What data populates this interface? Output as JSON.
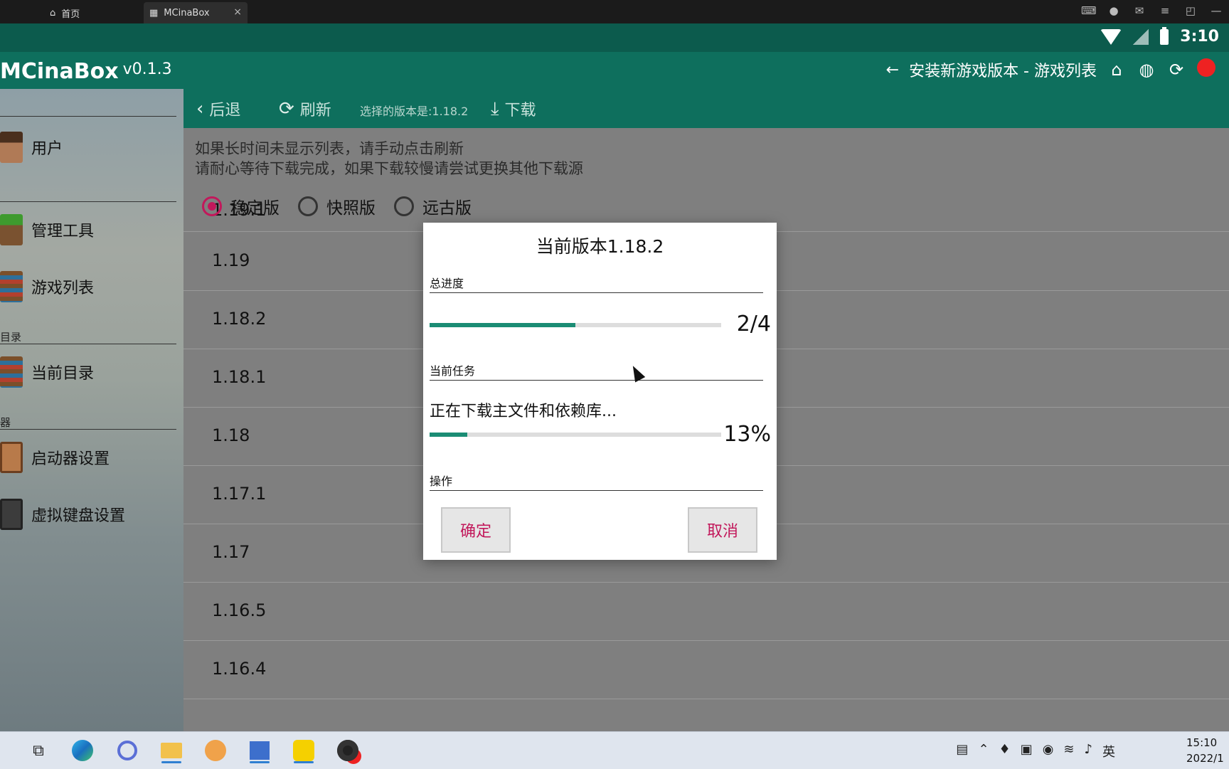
{
  "browser": {
    "tabs": [
      {
        "label": "首页",
        "icon": "home-icon"
      },
      {
        "label": "MCinaBox",
        "icon": "minecraft-icon",
        "close": "×"
      }
    ],
    "window_controls": [
      "gamepad-icon",
      "account-icon",
      "mail-icon",
      "menu-icon",
      "restore-icon",
      "minimize-icon"
    ]
  },
  "statusbar": {
    "time": "3:10"
  },
  "appbar": {
    "title": "MCinaBox",
    "version": "v0.1.3",
    "back_arrow": "←",
    "page_title": "安装新游戏版本 - 游戏列表",
    "icons": [
      "home-icon",
      "globe-icon",
      "sync-icon",
      "alert-icon"
    ]
  },
  "sidebar": {
    "items": [
      {
        "label": "用户"
      },
      {
        "label": "管理工具"
      },
      {
        "label": "游戏列表"
      },
      {
        "label": "当前目录"
      },
      {
        "label": "启动器设置"
      },
      {
        "label": "虚拟键盘设置"
      }
    ],
    "sections": [
      "目录",
      "器"
    ]
  },
  "toolbar": {
    "back_label": "后退",
    "refresh_label": "刷新",
    "selected_version": "选择的版本是:1.18.2",
    "download_label": "下载"
  },
  "hints": {
    "line1": "如果长时间未显示列表，请手动点击刷新",
    "line2": "请耐心等待下载完成，如果下载较慢请尝试更换其他下载源"
  },
  "filters": [
    {
      "label": "稳定版",
      "selected": true
    },
    {
      "label": "快照版",
      "selected": false
    },
    {
      "label": "远古版",
      "selected": false
    }
  ],
  "versions": [
    "1.19.1",
    "1.19",
    "1.18.2",
    "1.18.1",
    "1.18",
    "1.17.1",
    "1.17",
    "1.16.5",
    "1.16.4"
  ],
  "dialog": {
    "title": "当前版本1.18.2",
    "total_label": "总进度",
    "total_value": "2/4",
    "total_fraction": 0.5,
    "task_label": "当前任务",
    "task_text": "正在下载主文件和依赖库...",
    "task_value": "13%",
    "task_fraction": 0.13,
    "ops_label": "操作",
    "confirm": "确定",
    "cancel": "取消"
  },
  "taskbar": {
    "tray_lang": "英",
    "clock_time": "15:10",
    "clock_date": "2022/1"
  },
  "colors": {
    "accent": "#0e6f5d",
    "progress": "#1b8c74",
    "button_text": "#c2185b"
  }
}
